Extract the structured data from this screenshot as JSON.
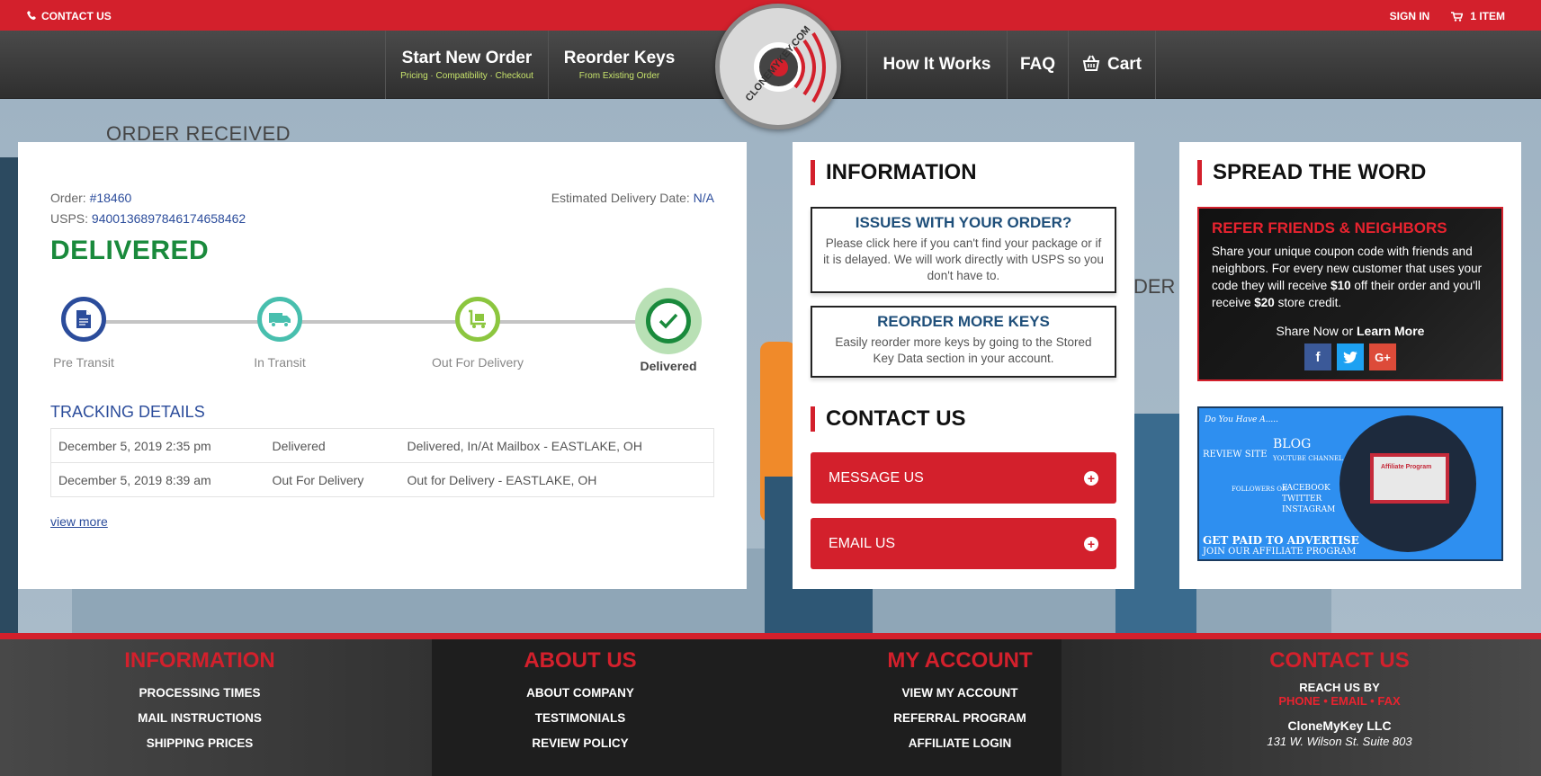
{
  "topbar": {
    "contact_label": "CONTACT US",
    "signin_label": "SIGN IN",
    "cart_label": "1 ITEM"
  },
  "nav": {
    "items": [
      {
        "label": "Start New Order",
        "sub": "Pricing · Compatibility · Checkout"
      },
      {
        "label": "Reorder Keys",
        "sub": "From Existing Order"
      },
      {
        "label": "How It Works"
      },
      {
        "label": "FAQ"
      },
      {
        "label": "Cart"
      }
    ],
    "logo_text": "CLONEMYKEY.COM"
  },
  "background": {
    "ghost_heading": "ORDER RECEIVED",
    "ghost_fragment": "DER"
  },
  "order": {
    "order_label": "Order:",
    "order_number": "#18460",
    "usps_label": "USPS:",
    "usps_number": "9400136897846174658462",
    "est_label": "Estimated Delivery Date:",
    "est_value": "N/A",
    "status": "DELIVERED",
    "steps": [
      {
        "label": "Pre Transit"
      },
      {
        "label": "In Transit"
      },
      {
        "label": "Out For Delivery"
      },
      {
        "label": "Delivered"
      }
    ],
    "tracking_title": "TRACKING DETAILS",
    "tracking_rows": [
      {
        "date": "December 5, 2019 2:35 pm",
        "status": "Delivered",
        "detail": "Delivered, In/At Mailbox - EASTLAKE, OH"
      },
      {
        "date": "December 5, 2019 8:39 am",
        "status": "Out For Delivery",
        "detail": "Out for Delivery - EASTLAKE, OH"
      }
    ],
    "view_more": "view more"
  },
  "information": {
    "title": "INFORMATION",
    "box1_title": "ISSUES WITH YOUR ORDER?",
    "box1_text": "Please click here if you can't find your package or if it is delayed. We will work directly with USPS so you don't have to.",
    "box2_title": "REORDER MORE KEYS",
    "box2_text": "Easily reorder more keys by going to the Stored Key Data section in your account.",
    "contact_title": "CONTACT US",
    "message_btn": "MESSAGE US",
    "email_btn": "EMAIL US"
  },
  "spread": {
    "title": "SPREAD THE WORD",
    "refer_title": "REFER FRIENDS & NEIGHBORS",
    "refer_text_1": "Share your unique coupon code with friends and neighbors. For every new customer that uses your code they will receive ",
    "refer_amount_1": "$10",
    "refer_text_2": " off their order and you'll receive ",
    "refer_amount_2": "$20",
    "refer_text_3": " store credit.",
    "share_now": "Share Now or ",
    "learn_more": "Learn More",
    "affiliate": {
      "do_you_have": "Do You Have A.....",
      "review_site": "REVIEW SITE",
      "blog": "BLOG",
      "youtube": "YOUTUBE CHANNEL",
      "followers_on": "FOLLOWERS ON",
      "facebook": "FACEBOOK",
      "twitter": "TWITTER",
      "instagram": "INSTAGRAM",
      "get_paid": "GET PAID TO ADVERTISE",
      "join": "JOIN OUR AFFILIATE PROGRAM",
      "screen_label": "Affiliate Program"
    }
  },
  "footer": {
    "col1": {
      "title": "INFORMATION",
      "links": [
        "PROCESSING TIMES",
        "MAIL INSTRUCTIONS",
        "SHIPPING PRICES"
      ]
    },
    "col2": {
      "title": "ABOUT US",
      "links": [
        "ABOUT COMPANY",
        "TESTIMONIALS",
        "REVIEW POLICY"
      ]
    },
    "col3": {
      "title": "MY ACCOUNT",
      "links": [
        "VIEW MY ACCOUNT",
        "REFERRAL PROGRAM",
        "AFFILIATE LOGIN"
      ]
    },
    "col4": {
      "title": "CONTACT US",
      "reach": "REACH US BY",
      "methods": "PHONE • EMAIL • FAX",
      "company": "CloneMyKey LLC",
      "address": "131 W. Wilson St. Suite 803"
    }
  }
}
